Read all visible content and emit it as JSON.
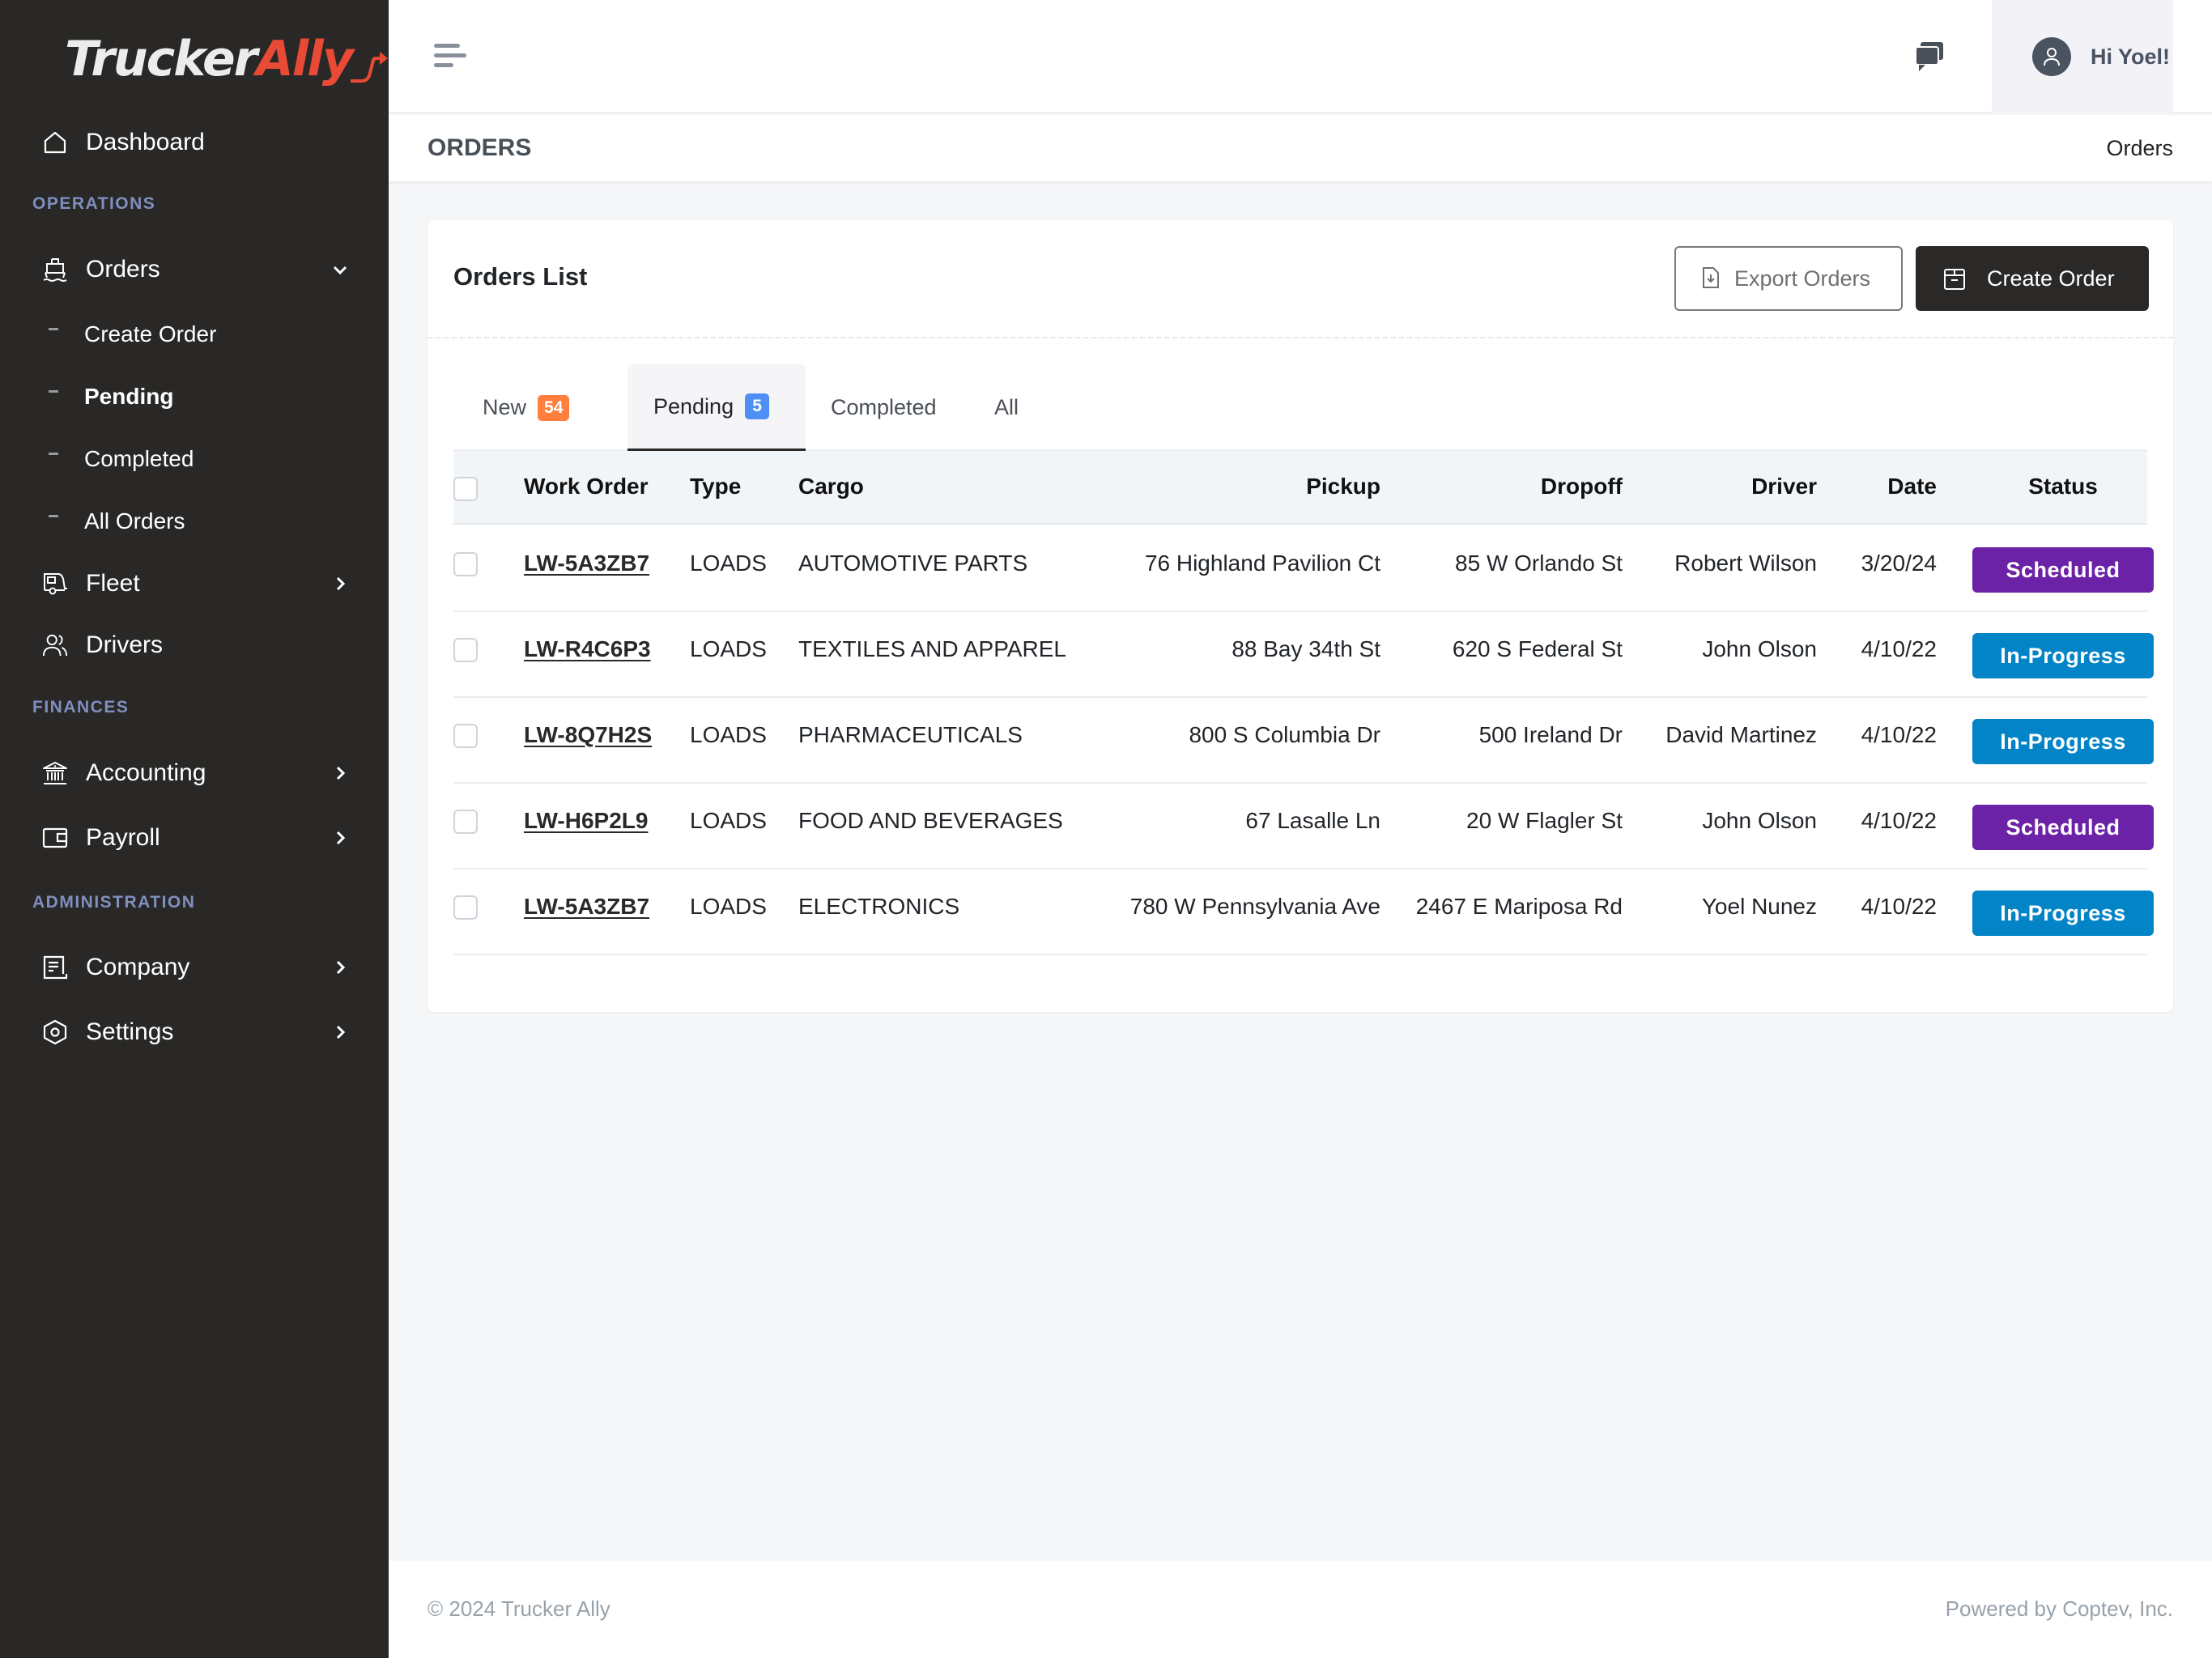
{
  "brand": {
    "part1": "Trucker",
    "part2": "Ally",
    "accent": "#e84a35"
  },
  "sidebar": {
    "dashboard": {
      "label": "Dashboard",
      "icon": "home-icon"
    },
    "sections": {
      "operations": "OPERATIONS",
      "finances": "FINANCES",
      "administration": "ADMINISTRATION"
    },
    "orders": {
      "label": "Orders",
      "icon": "ship-icon",
      "expanded": true,
      "children": [
        {
          "label": "Create Order",
          "active": false
        },
        {
          "label": "Pending",
          "active": true
        },
        {
          "label": "Completed",
          "active": false
        },
        {
          "label": "All Orders",
          "active": false
        }
      ]
    },
    "fleet": {
      "label": "Fleet",
      "icon": "trailer-icon"
    },
    "drivers": {
      "label": "Drivers",
      "icon": "users-icon"
    },
    "accounting": {
      "label": "Accounting",
      "icon": "bank-icon"
    },
    "payroll": {
      "label": "Payroll",
      "icon": "wallet-icon"
    },
    "company": {
      "label": "Company",
      "icon": "document-icon"
    },
    "settings": {
      "label": "Settings",
      "icon": "settings-hex-icon"
    }
  },
  "header": {
    "greeting": "Hi Yoel!",
    "page_title": "ORDERS",
    "breadcrumb": "Orders"
  },
  "card": {
    "title": "Orders List",
    "export_label": "Export Orders",
    "create_label": "Create Order",
    "tabs": [
      {
        "label": "New",
        "count": "54",
        "badge_color": "#ff7f3f",
        "active": false
      },
      {
        "label": "Pending",
        "count": "5",
        "badge_color": "#4d8ff5",
        "active": true
      },
      {
        "label": "Completed",
        "count": null,
        "active": false
      },
      {
        "label": "All",
        "count": null,
        "active": false
      }
    ],
    "columns": [
      "Work Order",
      "Type",
      "Cargo",
      "Pickup",
      "Dropoff",
      "Driver",
      "Date",
      "Status"
    ],
    "rows": [
      {
        "work_order": "LW-5A3ZB7",
        "type": "LOADS",
        "cargo": "AUTOMOTIVE PARTS",
        "pickup": "76 Highland Pavilion Ct",
        "dropoff": "85 W Orlando St",
        "driver": "Robert Wilson",
        "date": "3/20/24",
        "status": "Scheduled"
      },
      {
        "work_order": "LW-R4C6P3",
        "type": "LOADS",
        "cargo": "TEXTILES AND APPAREL",
        "pickup": "88 Bay 34th St",
        "dropoff": "620 S Federal St",
        "driver": "John Olson",
        "date": "4/10/22",
        "status": "In-Progress"
      },
      {
        "work_order": "LW-8Q7H2S",
        "type": "LOADS",
        "cargo": "PHARMACEUTICALS",
        "pickup": "800 S Columbia Dr",
        "dropoff": "500 Ireland Dr",
        "driver": "David Martinez",
        "date": "4/10/22",
        "status": "In-Progress"
      },
      {
        "work_order": "LW-H6P2L9",
        "type": "LOADS",
        "cargo": "FOOD AND BEVERAGES",
        "pickup": "67 Lasalle Ln",
        "dropoff": "20 W Flagler St",
        "driver": "John Olson",
        "date": "4/10/22",
        "status": "Scheduled"
      },
      {
        "work_order": "LW-5A3ZB7",
        "type": "LOADS",
        "cargo": "ELECTRONICS",
        "pickup": "780 W Pennsylvania Ave",
        "dropoff": "2467 E Mariposa Rd",
        "driver": "Yoel Nunez",
        "date": "4/10/22",
        "status": "In-Progress"
      }
    ],
    "status_colors": {
      "Scheduled": "#6c22a6",
      "In-Progress": "#0284c7"
    }
  },
  "footer": {
    "copyright": "© 2024 Trucker Ally",
    "powered_by": "Powered by Coptev, Inc."
  }
}
